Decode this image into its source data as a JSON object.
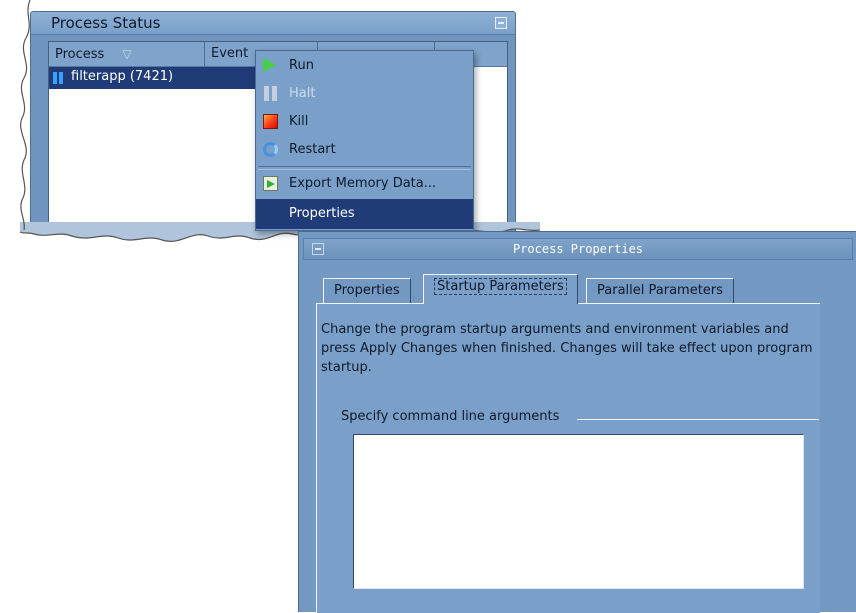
{
  "status_window": {
    "title": "Process Status",
    "columns": [
      "Process",
      "Event",
      ""
    ],
    "rows": [
      {
        "process": "filterapp (7421)"
      }
    ]
  },
  "context_menu": {
    "items": [
      {
        "label": "Run",
        "icon": "play-icon",
        "enabled": true
      },
      {
        "label": "Halt",
        "icon": "pause-icon",
        "enabled": false
      },
      {
        "label": "Kill",
        "icon": "stop-icon",
        "enabled": true
      },
      {
        "label": "Restart",
        "icon": "refresh-icon",
        "enabled": true
      },
      {
        "label": "Export Memory Data...",
        "icon": "export-icon",
        "enabled": true
      },
      {
        "label": "Properties",
        "selected": true,
        "enabled": true
      }
    ]
  },
  "properties_dialog": {
    "title": "Process Properties",
    "tabs": [
      {
        "label": "Properties"
      },
      {
        "label": "Startup Parameters",
        "active": true
      },
      {
        "label": "Parallel Parameters"
      }
    ],
    "description": "Change the program startup arguments and environment variables and press Apply Changes when finished.  Changes will take effect upon program startup.",
    "args_group_label": "Specify command line arguments",
    "args_value": ""
  },
  "colors": {
    "panel": "#7398c1",
    "selection": "#1f3b78",
    "run_icon": "#44d244",
    "kill_icon": "#ff3a1a"
  }
}
